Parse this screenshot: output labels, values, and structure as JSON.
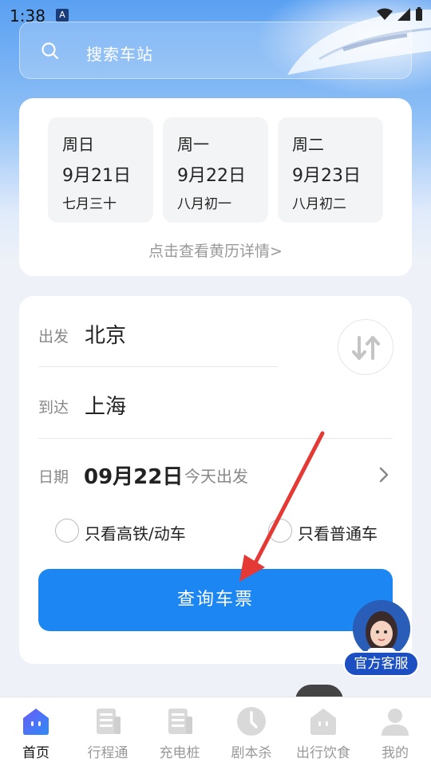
{
  "status_bar": {
    "time": "1:38",
    "app_badge": "A"
  },
  "search": {
    "placeholder": "搜索车站",
    "hint": ""
  },
  "calendar": {
    "days": [
      {
        "weekday": "周日",
        "date": "9月21日",
        "lunar": "七月三十"
      },
      {
        "weekday": "周一",
        "date": "9月22日",
        "lunar": "八月初一"
      },
      {
        "weekday": "周二",
        "date": "9月23日",
        "lunar": "八月初二"
      }
    ],
    "link": "点击查看黄历详情>"
  },
  "booking": {
    "from_label": "出发",
    "from_city": "北京",
    "to_label": "到达",
    "to_city": "上海",
    "date_label": "日期",
    "date_value": "09月22日",
    "date_note": "今天出发",
    "option_high_speed": "只看高铁/动车",
    "option_regular": "只看普通车",
    "query_button": "查询车票"
  },
  "customer_service": {
    "label": "官方客服"
  },
  "bottom_nav": {
    "items": [
      {
        "label": "首页",
        "icon": "home-icon",
        "active": true
      },
      {
        "label": "行程通",
        "icon": "itinerary-icon",
        "active": false
      },
      {
        "label": "充电桩",
        "icon": "charging-icon",
        "active": false
      },
      {
        "label": "剧本杀",
        "icon": "clock-icon",
        "active": false
      },
      {
        "label": "出行饮食",
        "icon": "food-icon",
        "active": false
      },
      {
        "label": "我的",
        "icon": "profile-icon",
        "active": false
      }
    ]
  },
  "colors": {
    "primary": "#1c87f2",
    "cs_badge": "#1b4fc2",
    "annotation": "#e53935"
  }
}
